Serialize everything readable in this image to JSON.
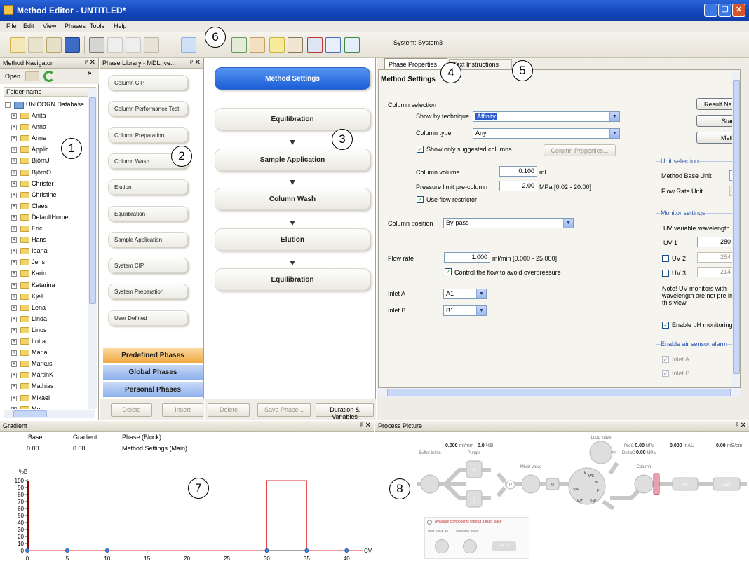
{
  "window": {
    "title": "Method Editor - UNTITLED*"
  },
  "menu": [
    "File",
    "Edit",
    "View",
    "Phases",
    "Tools",
    "Help"
  ],
  "toolbar": {
    "system_label": "System:",
    "system_name": "System3"
  },
  "navigator": {
    "title": "Method Navigator",
    "open_label": "Open",
    "more": "»",
    "column_header": "Folder name",
    "root": "UNICORN Database",
    "folders": [
      "Anita",
      "Anna",
      "Anne",
      "Applic",
      "BjörnJ",
      "BjörnO",
      "Christer",
      "Christine",
      "Claes",
      "DefaultHome",
      "Eric",
      "Hans",
      "Ioana",
      "Jens",
      "Karin",
      "Katarina",
      "Kjell",
      "Lena",
      "Linda",
      "Linus",
      "Lotta",
      "Maria",
      "Markus",
      "MartinK",
      "Mathias",
      "Mikael",
      "Moa"
    ]
  },
  "phase_library": {
    "title": "Phase Library - MDL, ve...",
    "phases": [
      "Column CIP",
      "Column Performance Test",
      "Column Preparation",
      "Column Wash",
      "Elution",
      "Equilibration",
      "Sample Application",
      "System CIP",
      "System Preparation",
      "User Defined"
    ],
    "categories": [
      "Predefined Phases",
      "Global Phases",
      "Personal Phases"
    ],
    "delete_label": "Delete",
    "insert_label": "Insert"
  },
  "method_outline": {
    "blocks": [
      "Method Settings",
      "Equilibration",
      "Sample Application",
      "Column Wash",
      "Elution",
      "Equilibration"
    ],
    "delete_label": "Delete",
    "save_label": "Save Phase...",
    "duration_label": "Duration & Variables"
  },
  "tabs": [
    "Phase Properties",
    "Text Instructions"
  ],
  "method_settings": {
    "heading": "Method Settings",
    "column_selection": "Column selection",
    "show_by_technique": "Show by technique",
    "technique_value": "Affinity",
    "column_type": "Column type",
    "column_type_value": "Any",
    "show_suggested": "Show only suggested columns",
    "column_properties": "Column Properties...",
    "column_volume": "Column volume",
    "column_volume_value": "0.100",
    "column_volume_unit": "ml",
    "pressure_limit": "Pressure limit pre-column",
    "pressure_value": "2.00",
    "pressure_unit": "MPa [0.02 - 20.00]",
    "use_flow_restrictor": "Use flow restrictor",
    "column_position": "Column position",
    "column_position_value": "By-pass",
    "flow_rate": "Flow rate",
    "flow_rate_value": "1.000",
    "flow_rate_unit": "ml/min  [0.000 - 25.000]",
    "control_flow": "Control the flow to avoid overpressure",
    "inlet_a": "Inlet A",
    "inlet_a_value": "A1",
    "inlet_b": "Inlet B",
    "inlet_b_value": "B1",
    "result_name": "Result Na",
    "start": "Start",
    "method": "Meth",
    "unit_selection": "Unit selection",
    "method_base_unit": "Method Base Unit",
    "flow_rate_unit_label": "Flow Rate Unit",
    "monitor_settings": "Monitor settings",
    "uv_variable": "UV variable wavelength",
    "uv1": "UV 1",
    "uv1_value": "280",
    "uv2": "UV 2",
    "uv2_value": "254",
    "uv3": "UV 3",
    "uv3_value": "214",
    "note": "Note! UV monitors with wavelength are not pre in this view",
    "enable_ph": "Enable pH monitoring",
    "air_sensor": "Enable air sensor alarm",
    "air_inlet_a": "Inlet A",
    "air_inlet_b": "Inlet B"
  },
  "gradient": {
    "title": "Gradient",
    "col_base": "Base",
    "col_gradient": "Gradient",
    "col_phase": "Phase (Block)",
    "row_base": "0.00",
    "row_gradient": "0.00",
    "row_phase": "Method Settings (Main)"
  },
  "chart_data": {
    "type": "line",
    "ylabel": "%B",
    "xlabel": "CV",
    "xlim": [
      0,
      42
    ],
    "ylim": [
      0,
      100
    ],
    "x_ticks": [
      0,
      5,
      10,
      15,
      20,
      25,
      30,
      35,
      40
    ],
    "y_ticks": [
      0,
      10,
      20,
      30,
      40,
      50,
      60,
      70,
      80,
      90,
      100
    ],
    "series": [
      {
        "x": [
          0,
          30,
          30,
          35,
          35,
          42
        ],
        "y": [
          0,
          0,
          100,
          100,
          0,
          0
        ]
      }
    ],
    "markers_x": [
      0,
      5,
      10,
      30,
      35,
      40
    ]
  },
  "process": {
    "title": "Process Picture",
    "flow": "0.000",
    "flow_unit": "ml/min",
    "pctb": "0.0",
    "pctb_unit": "%B",
    "prec_label": "PreC",
    "prec_value": "0.00",
    "prec_unit": "MPa",
    "deltac_label": "DeltaC",
    "deltac_value": "0.00",
    "deltac_unit": "MPa",
    "mau": "0.000",
    "mau_unit": "mAU",
    "cond": "0.00",
    "cond_unit": "mS/cm",
    "labels": {
      "buffer_inlets": "Buffer inlets",
      "pumps": "Pumps",
      "mixer_valve": "Mixer valve",
      "loop_valve": "Loop valve",
      "column": "Column",
      "a": "A",
      "b": "B",
      "p": "P",
      "m": "M",
      "uv": "UV",
      "cond": "Cond",
      "ws": "WS",
      "col": "Col",
      "e": "E",
      "syp": "SyP",
      "f": "F",
      "wz": "WZ",
      "sap": "SaP",
      "loop": "Loop"
    },
    "avail": "Available components without a fixed place",
    "inlet_valve": "Inlet valve X1",
    "versatile_valve": "Versatile valve",
    "air": "Air 1"
  },
  "callouts": [
    "1",
    "2",
    "3",
    "4",
    "5",
    "6",
    "7",
    "8"
  ]
}
